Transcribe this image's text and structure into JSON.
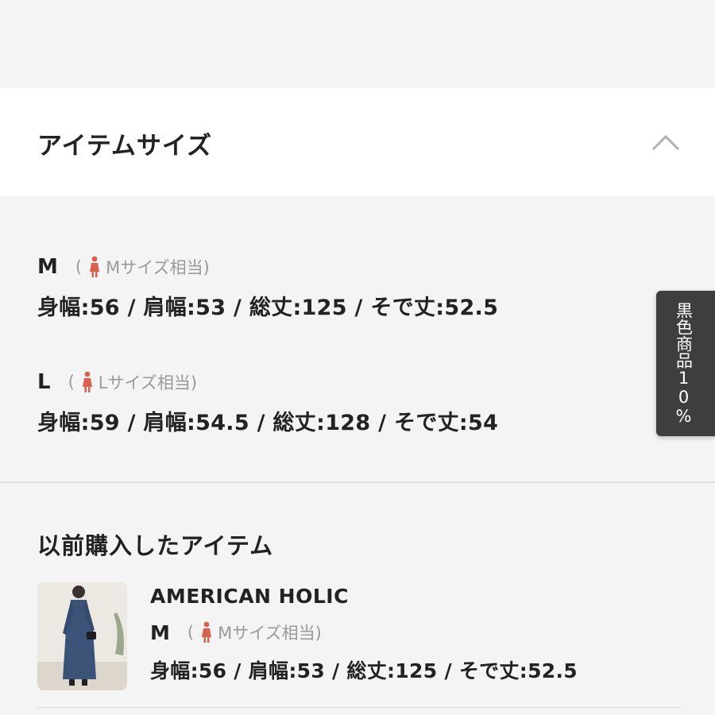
{
  "section": {
    "title": "アイテムサイズ",
    "toggle_icon": "chevron-up-icon"
  },
  "sizes": [
    {
      "letter": "M",
      "note_open": "(",
      "note_text": "Mサイズ相当)",
      "icon": "woman-figure-icon",
      "measurements": "身幅:56 / 肩幅:53 / 総丈:125 / そで丈:52.5"
    },
    {
      "letter": "L",
      "note_open": "(",
      "note_text": "Lサイズ相当)",
      "icon": "woman-figure-icon",
      "measurements": "身幅:59 / 肩幅:54.5 / 総丈:128 / そで丈:54"
    }
  ],
  "previous": {
    "title": "以前購入したアイテム",
    "items": [
      {
        "brand": "AMERICAN HOLIC",
        "size_letter": "M",
        "note_open": "(",
        "note_text": "Mサイズ相当)",
        "measurements": "身幅:56 / 肩幅:53 / 総丈:125 / そで丈:52.5"
      }
    ]
  },
  "side_tab": {
    "label": "黒色商品10%"
  },
  "colors": {
    "accent_icon": "#d9604f",
    "side_tab_bg": "#3e3e3e"
  }
}
